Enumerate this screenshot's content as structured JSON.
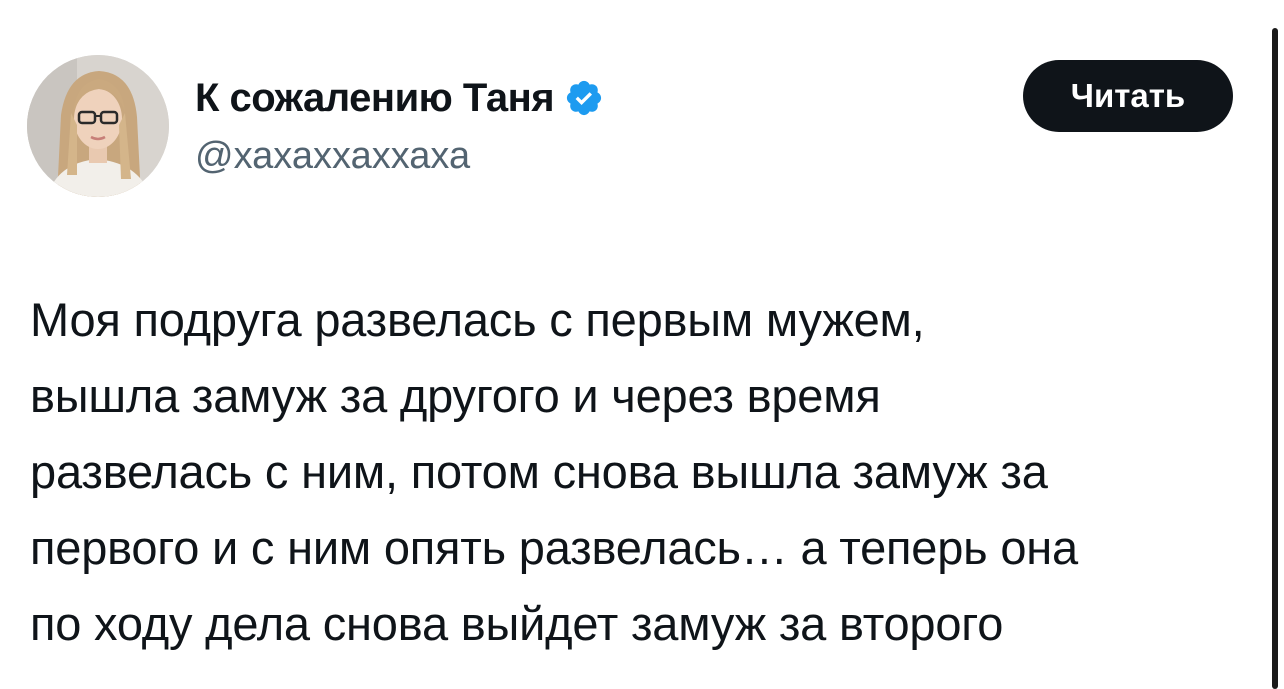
{
  "author": {
    "display_name": "К сожалению Таня",
    "handle": "@хахаххаххаха",
    "verified": true,
    "verified_icon": "verified-badge-icon",
    "verified_color": "#1d9bf0"
  },
  "follow_button": {
    "label": "Читать"
  },
  "tweet": {
    "lines": [
      "Моя подруга развелась с первым мужем,",
      "вышла замуж за другого и через время",
      "развелась с ним, потом снова вышла замуж за",
      "первого и с ним опять развелась… а теперь она",
      "по ходу дела снова выйдет замуж за второго"
    ]
  },
  "colors": {
    "text": "#0f1419",
    "secondary": "#536471",
    "button_bg": "#0f1419",
    "button_text": "#ffffff",
    "background": "#ffffff"
  }
}
